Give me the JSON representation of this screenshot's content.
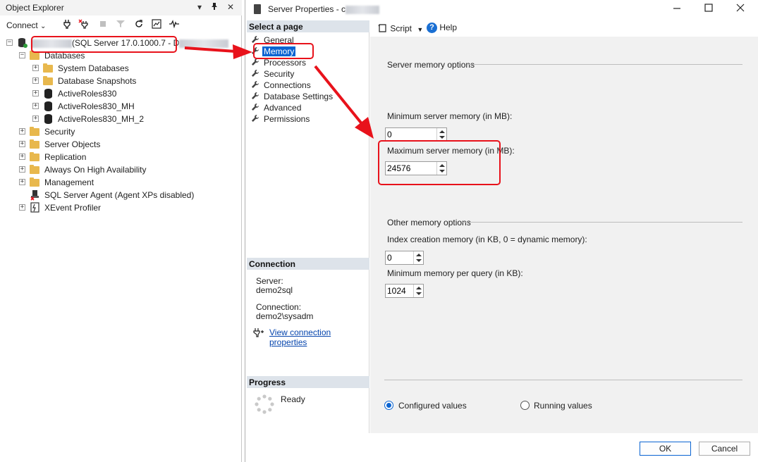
{
  "object_explorer": {
    "title": "Object Explorer",
    "title_controls": [
      "▾",
      "📌",
      "✕"
    ],
    "connect_label": "Connect",
    "server_label": "(SQL Server 17.0.1000.7 - D",
    "tree": [
      {
        "label": "Databases",
        "level": 1,
        "expander": "−",
        "icon": "folder-icon"
      },
      {
        "label": "System Databases",
        "level": 2,
        "expander": "+",
        "icon": "folder-icon"
      },
      {
        "label": "Database Snapshots",
        "level": 2,
        "expander": "+",
        "icon": "folder-icon"
      },
      {
        "label": "ActiveRoles830",
        "level": 2,
        "expander": "+",
        "icon": "database-icon"
      },
      {
        "label": "ActiveRoles830_MH",
        "level": 2,
        "expander": "+",
        "icon": "database-icon"
      },
      {
        "label": "ActiveRoles830_MH_2",
        "level": 2,
        "expander": "+",
        "icon": "database-icon"
      },
      {
        "label": "Security",
        "level": 1,
        "expander": "+",
        "icon": "folder-icon"
      },
      {
        "label": "Server Objects",
        "level": 1,
        "expander": "+",
        "icon": "folder-icon"
      },
      {
        "label": "Replication",
        "level": 1,
        "expander": "+",
        "icon": "folder-icon"
      },
      {
        "label": "Always On High Availability",
        "level": 1,
        "expander": "+",
        "icon": "folder-icon"
      },
      {
        "label": "Management",
        "level": 1,
        "expander": "+",
        "icon": "folder-icon"
      },
      {
        "label": "SQL Server Agent (Agent XPs disabled)",
        "level": 1,
        "expander": "",
        "icon": "agent-icon"
      },
      {
        "label": "XEvent Profiler",
        "level": 1,
        "expander": "+",
        "icon": "profiler-icon"
      }
    ]
  },
  "dialog": {
    "title": "Server Properties - c",
    "select_page_header": "Select a page",
    "pages": [
      {
        "label": "General",
        "selected": false
      },
      {
        "label": "Memory",
        "selected": true
      },
      {
        "label": "Processors",
        "selected": false
      },
      {
        "label": "Security",
        "selected": false
      },
      {
        "label": "Connections",
        "selected": false
      },
      {
        "label": "Database Settings",
        "selected": false
      },
      {
        "label": "Advanced",
        "selected": false
      },
      {
        "label": "Permissions",
        "selected": false
      }
    ],
    "connection": {
      "header": "Connection",
      "server_label": "Server:",
      "server_value": "demo2sql",
      "connection_label": "Connection:",
      "connection_value": "demo2\\sysadm",
      "view_link": "View connection properties"
    },
    "progress": {
      "header": "Progress",
      "status": "Ready"
    },
    "toolbar": {
      "script_label": "Script",
      "help_label": "Help"
    },
    "memory": {
      "server_memory_group": "Server memory options",
      "min_label": "Minimum server memory (in MB):",
      "min_value": "0",
      "max_label": "Maximum server memory (in MB):",
      "max_value": "24576",
      "other_group": "Other memory options",
      "index_label": "Index creation memory (in KB, 0 = dynamic memory):",
      "index_value": "0",
      "min_query_label": "Minimum memory per query (in KB):",
      "min_query_value": "1024",
      "configured_label": "Configured values",
      "running_label": "Running values",
      "configured_selected": true
    },
    "buttons": {
      "ok": "OK",
      "cancel": "Cancel"
    }
  },
  "colors": {
    "highlight_red": "#e8121b",
    "selection_blue": "#0a64d2",
    "section_header": "#dde3ea",
    "content_bg": "#f1f1f1"
  }
}
